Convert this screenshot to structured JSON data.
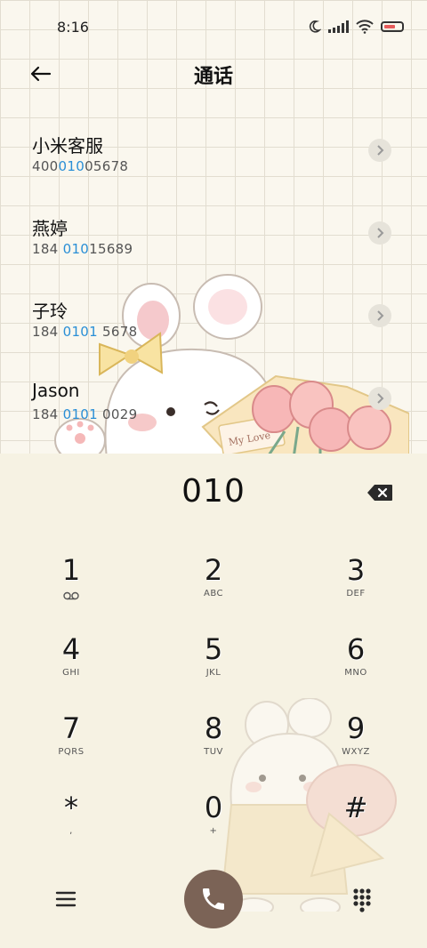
{
  "status_bar": {
    "time": "8:16"
  },
  "header": {
    "title": "通话"
  },
  "contacts": [
    {
      "name": "小米客服",
      "num_prefix": "400",
      "num_highlight": "010",
      "num_suffix": "05678"
    },
    {
      "name": "燕婷",
      "num_prefix": "184 ",
      "num_highlight": "010",
      "num_suffix": "15689"
    },
    {
      "name": "子玲",
      "num_prefix": "184 ",
      "num_highlight": "0101",
      "num_suffix": " 5678"
    },
    {
      "name": "Jason",
      "num_prefix": "184 ",
      "num_highlight": "0101",
      "num_suffix": " 0029"
    }
  ],
  "illustration": {
    "card_text": "My Love"
  },
  "dialer": {
    "display": "010",
    "keys": [
      {
        "digit": "1",
        "letters": ""
      },
      {
        "digit": "2",
        "letters": "ABC"
      },
      {
        "digit": "3",
        "letters": "DEF"
      },
      {
        "digit": "4",
        "letters": "GHI"
      },
      {
        "digit": "5",
        "letters": "JKL"
      },
      {
        "digit": "6",
        "letters": "MNO"
      },
      {
        "digit": "7",
        "letters": "PQRS"
      },
      {
        "digit": "8",
        "letters": "TUV"
      },
      {
        "digit": "9",
        "letters": "WXYZ"
      },
      {
        "digit": "*",
        "letters": ","
      },
      {
        "digit": "0",
        "letters": "+"
      },
      {
        "digit": "#",
        "letters": ""
      }
    ]
  },
  "colors": {
    "highlight": "#2a8fd6",
    "call_button": "#7b6356",
    "panel": "#f6f2e3"
  }
}
